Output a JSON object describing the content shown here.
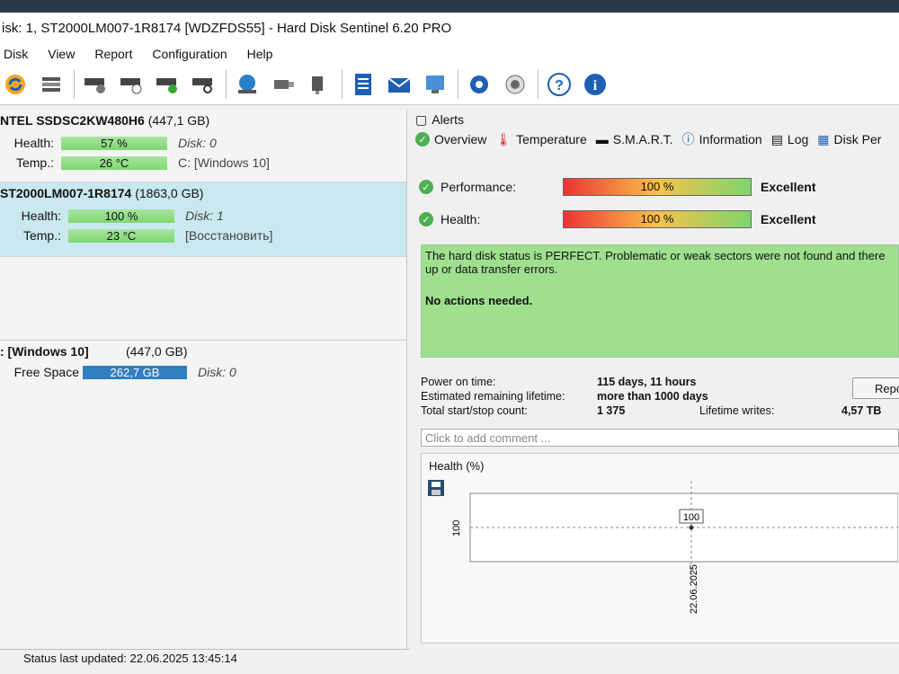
{
  "title": "isk: 1, ST2000LM007-1R8174 [WDZFDS55]  -  Hard Disk Sentinel 6.20 PRO",
  "menu": [
    "Disk",
    "View",
    "Report",
    "Configuration",
    "Help"
  ],
  "disks": [
    {
      "name": "NTEL SSDSC2KW480H6",
      "size": "(447,1 GB)",
      "health_label": "Health:",
      "health": "57 %",
      "disk_label": "Disk: 0",
      "temp_label": "Temp.:",
      "temp": "26 °C",
      "vol": "C: [Windows 10]"
    },
    {
      "name": "ST2000LM007-1R8174",
      "size": "(1863,0 GB)",
      "health_label": "Health:",
      "health": "100 %",
      "disk_label": "Disk: 1",
      "temp_label": "Temp.:",
      "temp": "23 °C",
      "vol": "[Восстановить]"
    }
  ],
  "volume": {
    "name": ": [Windows 10]",
    "size": "(447,0 GB)",
    "free_label": "Free Space",
    "free": "262,7 GB",
    "disk": "Disk: 0"
  },
  "tabs": {
    "alerts": "Alerts",
    "overview": "Overview",
    "temperature": "Temperature",
    "smart": "S.M.A.R.T.",
    "information": "Information",
    "log": "Log",
    "diskperf": "Disk Per"
  },
  "perf": {
    "label": "Performance:",
    "value": "100 %",
    "rating": "Excellent"
  },
  "health": {
    "label": "Health:",
    "value": "100 %",
    "rating": "Excellent"
  },
  "status_text": "The hard disk status is PERFECT. Problematic or weak sectors were not found and there up or data transfer errors.",
  "status_action": "No actions needed.",
  "info": {
    "power_on_label": "Power on time:",
    "power_on": "115 days, 11 hours",
    "lifetime_label": "Estimated remaining lifetime:",
    "lifetime": "more than 1000 days",
    "startstop_label": "Total start/stop count:",
    "startstop": "1 375",
    "writes_label": "Lifetime writes:",
    "writes": "4,57 TB"
  },
  "report_btn": "Repo",
  "comment_placeholder": "Click to add comment ...",
  "graph": {
    "title": "Health (%)",
    "ytick": "100",
    "point_label": "100",
    "xtick": "22.06.2025"
  },
  "statusbar": "Status last updated: 22.06.2025 13:45:14",
  "chart_data": {
    "type": "line",
    "title": "Health (%)",
    "x": [
      "22.06.2025"
    ],
    "values": [
      100
    ],
    "yticks": [
      "100"
    ]
  }
}
